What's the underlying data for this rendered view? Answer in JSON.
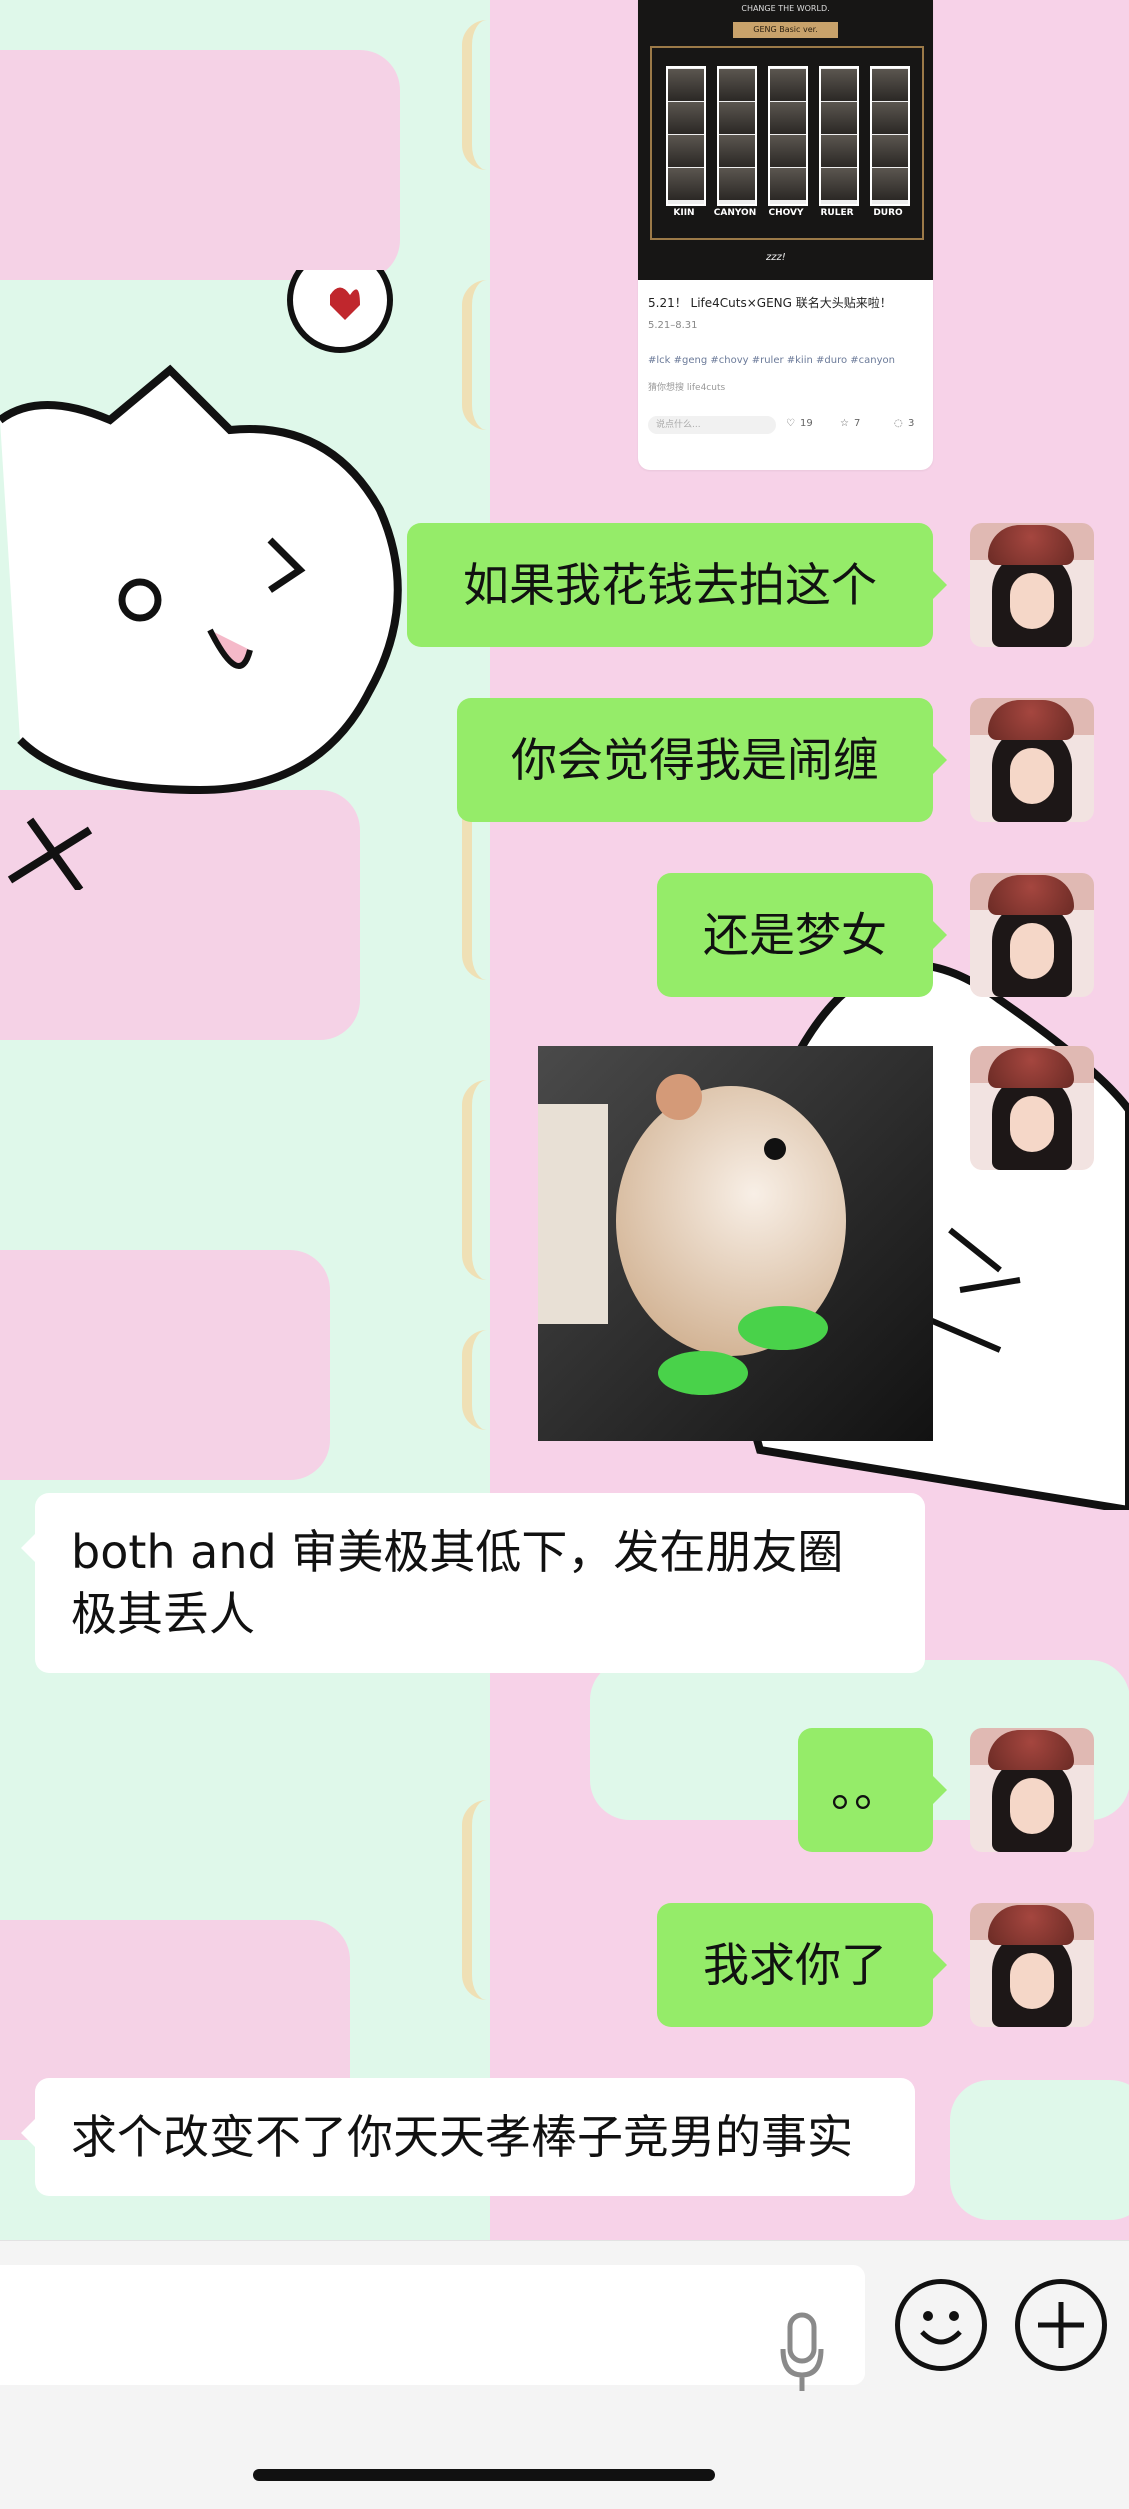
{
  "post": {
    "kicker": "CHANGE THE WORLD.",
    "banner": "GENG Basic ver.",
    "players": [
      "KIIN",
      "CANYON",
      "CHOVY",
      "RULER",
      "DURO"
    ],
    "signature": "zzz!",
    "title": "5.21！ Life4Cuts×GENG 联名大头贴来啦！",
    "date": "5.21–8.31",
    "tags": "#lck #geng #chovy #ruler #kiin #duro #canyon",
    "meta": "猜你想搜   life4cuts",
    "comment_placeholder": "说点什么...",
    "likes": "19",
    "stars": "7",
    "comments": "3"
  },
  "messages": [
    {
      "side": "right",
      "text": "如果我花钱去拍这个"
    },
    {
      "side": "right",
      "text": "你会觉得我是闹缠"
    },
    {
      "side": "right",
      "text": "还是梦女"
    },
    {
      "side": "right",
      "type": "sticker",
      "icon": "hamster-sticker"
    },
    {
      "side": "left",
      "text": "both and 审美极其低下，发在朋友圈极其丢人"
    },
    {
      "side": "right",
      "text": "。。"
    },
    {
      "side": "right",
      "text": "我求你了"
    },
    {
      "side": "left",
      "text": "求个改变不了你天天孝棒子竞男的事实"
    }
  ],
  "input_bar": {
    "voice_icon": "microphone-icon",
    "emoji_icon": "smiley-icon",
    "plus_icon": "plus-circle-icon"
  },
  "colors": {
    "outgoing_bubble": "#95ec69",
    "incoming_bubble": "#ffffff",
    "bg_mint": "#dff8ea",
    "bg_pink": "#f7d2e8"
  }
}
